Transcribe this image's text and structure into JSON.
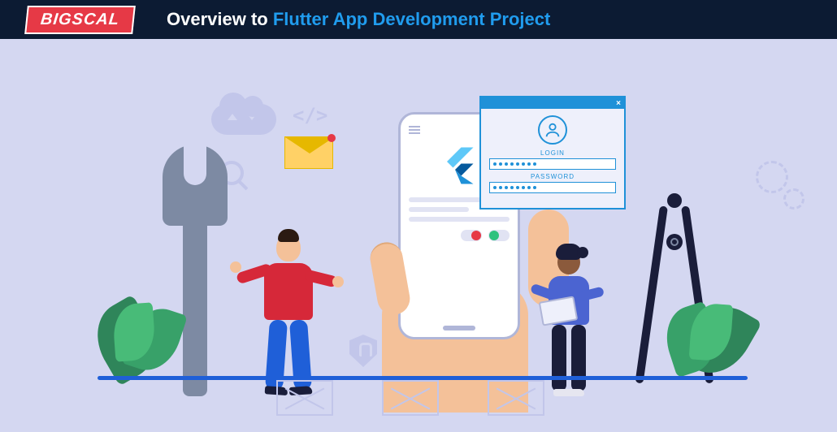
{
  "header": {
    "logo_text": "BIGSCAL",
    "title_part_1": "Overview to ",
    "title_part_2": "Flutter App Development Project"
  },
  "login_window": {
    "close_symbol": "×",
    "field_login_label": "LOGIN",
    "field_password_label": "PASSWORD"
  },
  "background": {
    "code_tag_text": "</>"
  },
  "colors": {
    "header_bg": "#0c1b33",
    "accent_red": "#e63946",
    "accent_blue": "#209cee",
    "canvas_bg": "#d4d7f1",
    "login_border": "#1f91d8",
    "ground_blue": "#1f5fd8"
  }
}
